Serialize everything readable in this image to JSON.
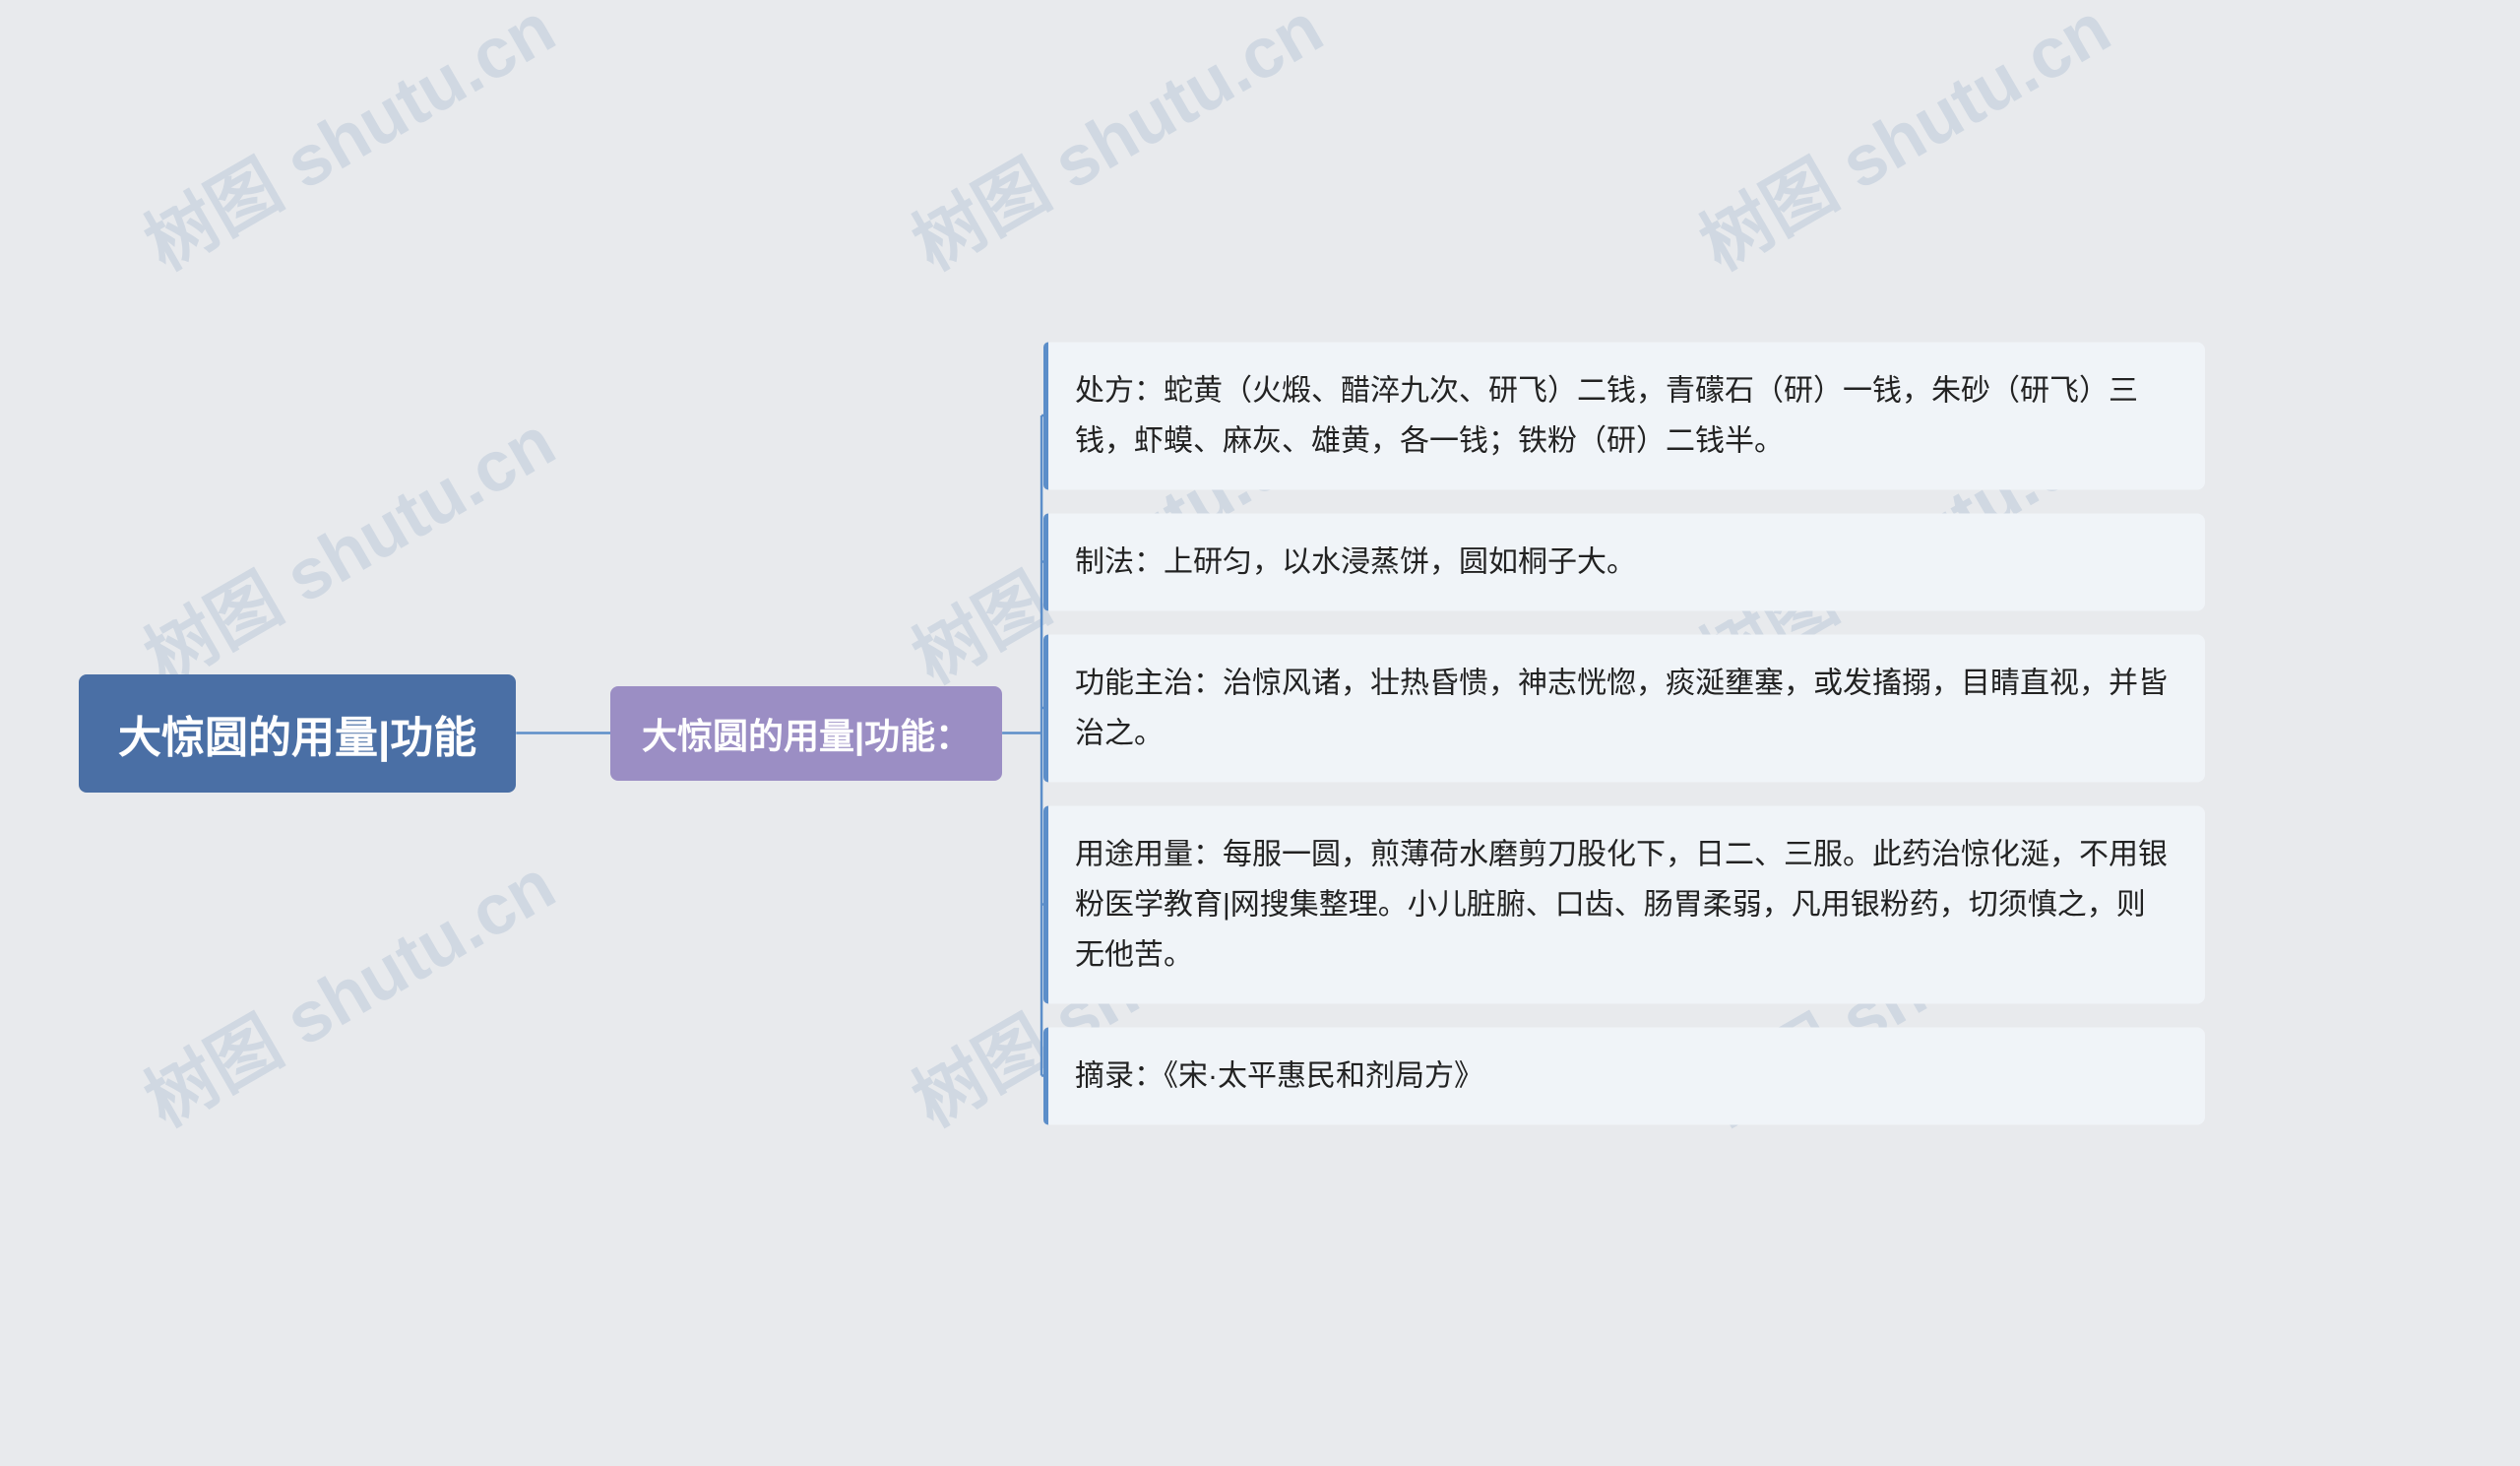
{
  "watermarks": [
    "树图 shutu.cn",
    "树图 shutu.cn",
    "树图 shutu.cn",
    "树图 shutu.cn",
    "树图 shutu.cn",
    "树图 shutu.cn",
    "树图 shutu.cn",
    "树图 shutu.cn",
    "树图 shutu.cn"
  ],
  "root": {
    "label": "大惊圆的用量|功能"
  },
  "second": {
    "label": "大惊圆的用量|功能："
  },
  "leaves": [
    {
      "text": "处方：蛇黄（火煅、醋淬九次、研飞）二钱，青礞石（研）一钱，朱砂（研飞）三钱，虾蟆、麻灰、雄黄，各一钱；铁粉（研）二钱半。"
    },
    {
      "text": "制法：上研匀，以水浸蒸饼，圆如桐子大。"
    },
    {
      "text": "功能主治：治惊风诸，壮热昏愦，神志恍惚，痰涎壅塞，或发搐搦，目睛直视，并皆治之。"
    },
    {
      "text": "用途用量：每服一圆，煎薄荷水磨剪刀股化下，日二、三服。此药治惊化涎，不用银粉医学教育|网搜集整理。小儿脏腑、口齿、肠胃柔弱，凡用银粉药，切须慎之，则无他苦。"
    },
    {
      "text": "摘录：《宋·太平惠民和剂局方》"
    }
  ],
  "colors": {
    "root_bg": "#4a6fa5",
    "second_bg": "#9b8ec4",
    "leaf_bg": "#f0f4f8",
    "line_color": "#5c8ec9",
    "accent_left": "#5c8ec9",
    "watermark": "rgba(100,140,180,0.18)"
  }
}
